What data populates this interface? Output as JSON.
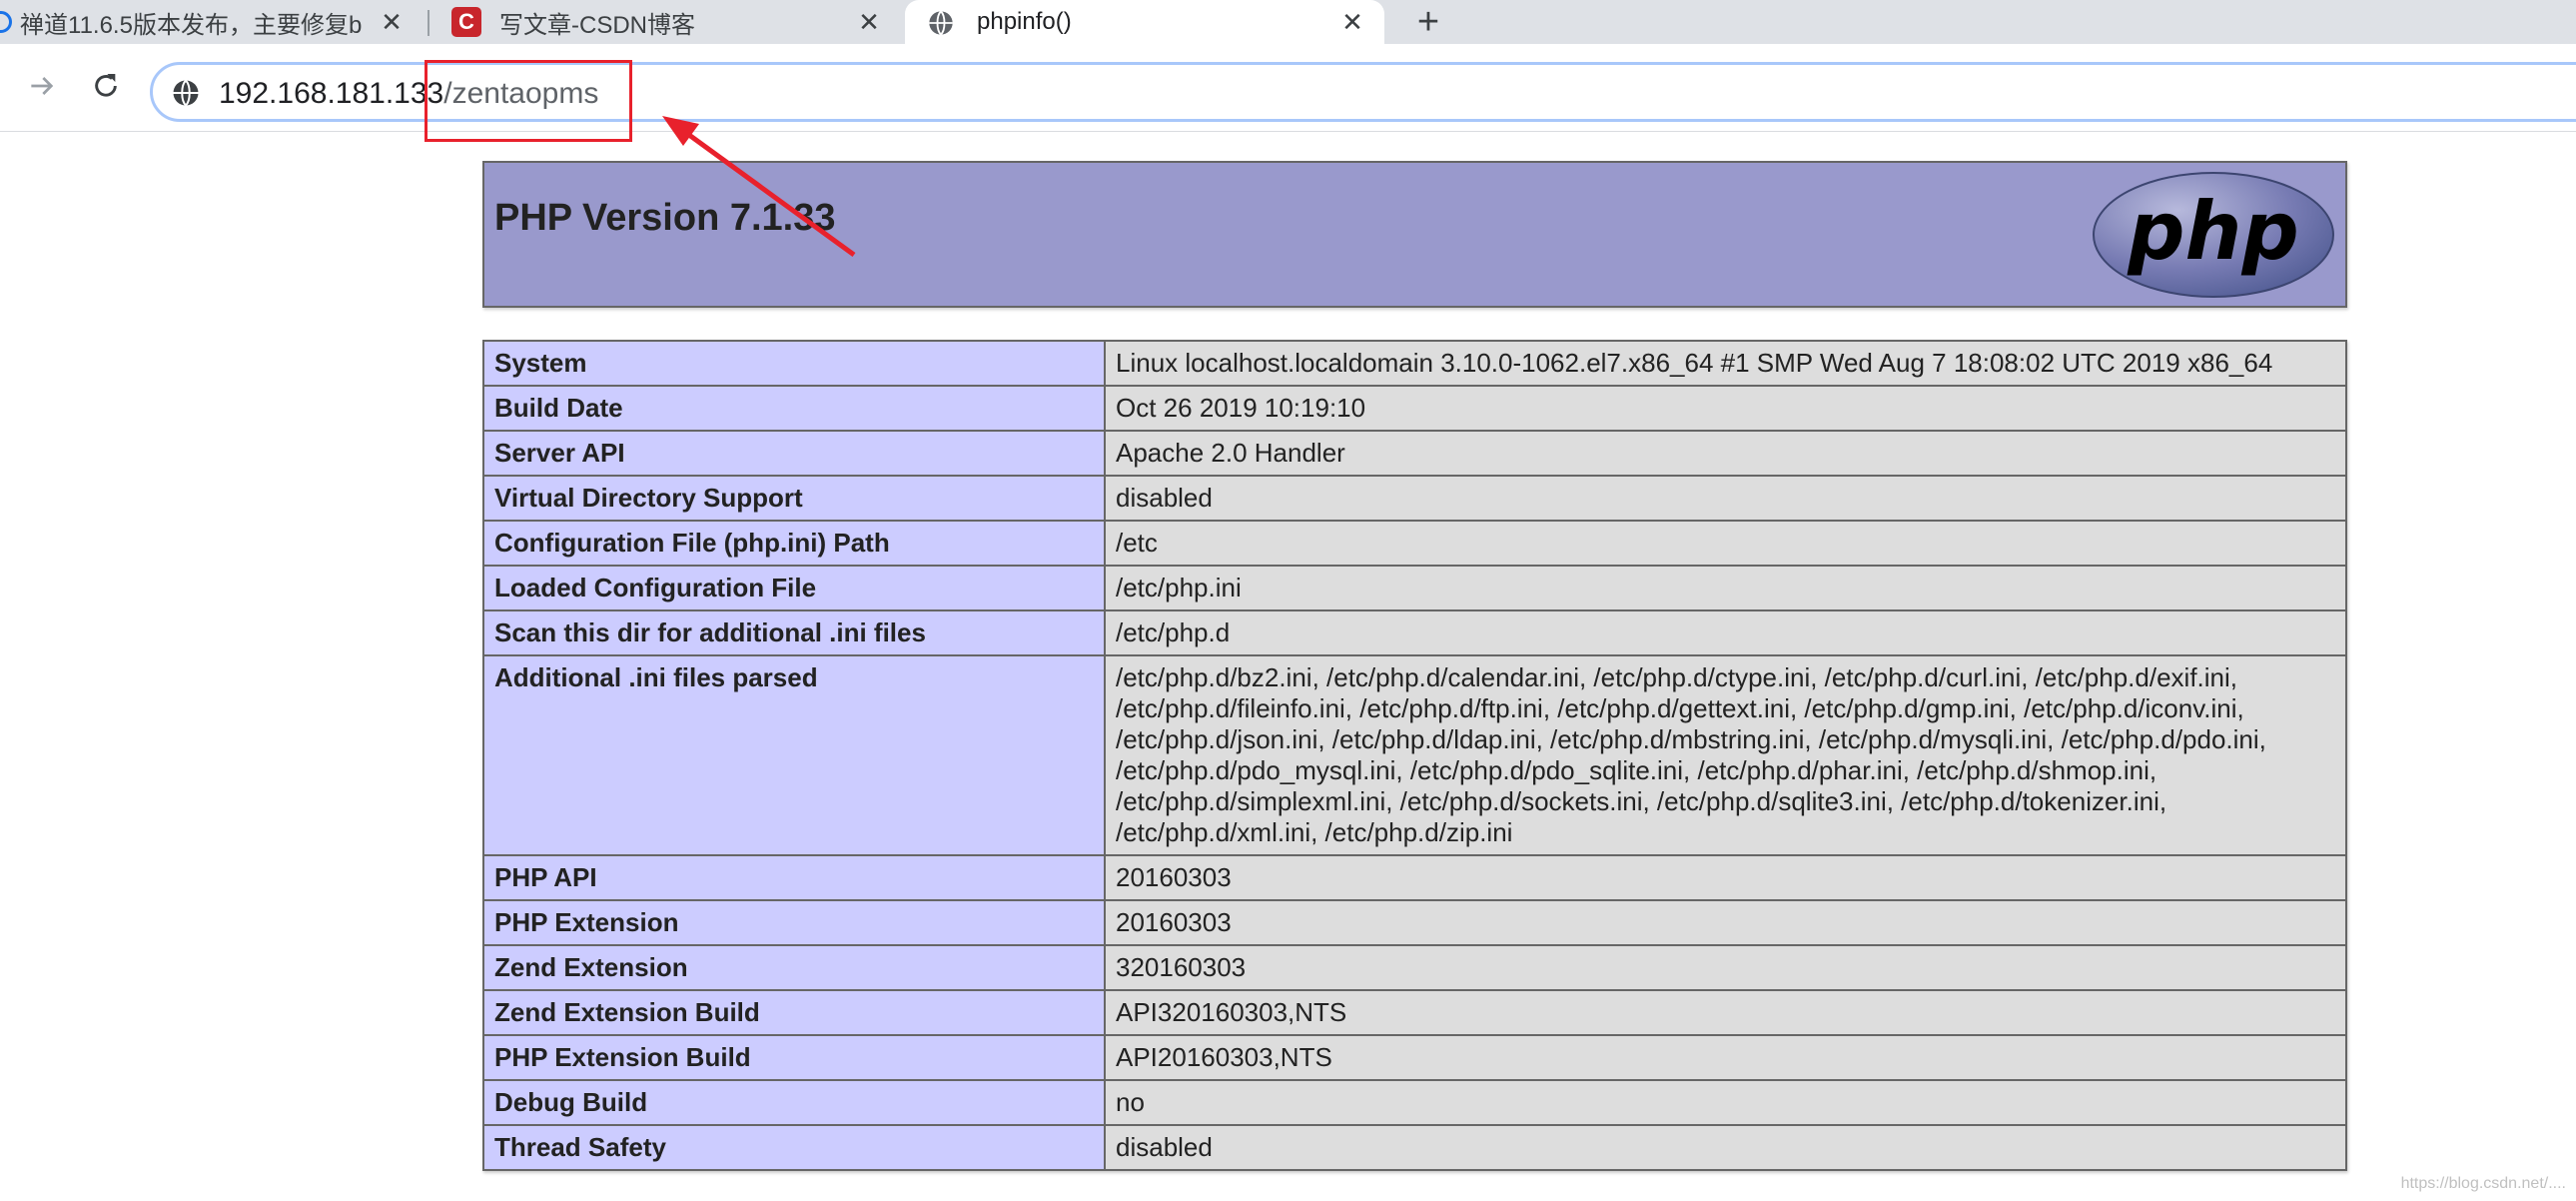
{
  "browser": {
    "tabs": [
      {
        "title": "禅道11.6.5版本发布，主要修复b",
        "icon": "globe-icon"
      },
      {
        "title": "写文章-CSDN博客",
        "icon": "csdn-logo-icon",
        "icon_letter": "C"
      },
      {
        "title": "phpinfo()",
        "icon": "globe-icon"
      }
    ],
    "close_glyph": "✕",
    "new_tab_glyph": "+",
    "address": {
      "host": "192.168.181.133",
      "path": "/zentaopms"
    }
  },
  "colors": {
    "header_bg": "#9999cc",
    "key_cell_bg": "#ccccff",
    "value_cell_bg": "#dddddd",
    "annotation_red": "#e8212c"
  },
  "page": {
    "title": "PHP Version 7.1.33",
    "logo_text": "php",
    "rows": [
      {
        "key": "System",
        "value": "Linux localhost.localdomain 3.10.0-1062.el7.x86_64 #1 SMP Wed Aug 7 18:08:02 UTC 2019 x86_64"
      },
      {
        "key": "Build Date",
        "value": "Oct 26 2019 10:19:10"
      },
      {
        "key": "Server API",
        "value": "Apache 2.0 Handler"
      },
      {
        "key": "Virtual Directory Support",
        "value": "disabled"
      },
      {
        "key": "Configuration File (php.ini) Path",
        "value": "/etc"
      },
      {
        "key": "Loaded Configuration File",
        "value": "/etc/php.ini"
      },
      {
        "key": "Scan this dir for additional .ini files",
        "value": "/etc/php.d"
      },
      {
        "key": "Additional .ini files parsed",
        "value": "/etc/php.d/bz2.ini, /etc/php.d/calendar.ini, /etc/php.d/ctype.ini, /etc/php.d/curl.ini, /etc/php.d/exif.ini, /etc/php.d/fileinfo.ini, /etc/php.d/ftp.ini, /etc/php.d/gettext.ini, /etc/php.d/gmp.ini, /etc/php.d/iconv.ini, /etc/php.d/json.ini, /etc/php.d/ldap.ini, /etc/php.d/mbstring.ini, /etc/php.d/mysqli.ini, /etc/php.d/pdo.ini, /etc/php.d/pdo_mysql.ini, /etc/php.d/pdo_sqlite.ini, /etc/php.d/phar.ini, /etc/php.d/shmop.ini, /etc/php.d/simplexml.ini, /etc/php.d/sockets.ini, /etc/php.d/sqlite3.ini, /etc/php.d/tokenizer.ini, /etc/php.d/xml.ini, /etc/php.d/zip.ini"
      },
      {
        "key": "PHP API",
        "value": "20160303"
      },
      {
        "key": "PHP Extension",
        "value": "20160303"
      },
      {
        "key": "Zend Extension",
        "value": "320160303"
      },
      {
        "key": "Zend Extension Build",
        "value": "API320160303,NTS"
      },
      {
        "key": "PHP Extension Build",
        "value": "API20160303,NTS"
      },
      {
        "key": "Debug Build",
        "value": "no"
      },
      {
        "key": "Thread Safety",
        "value": "disabled"
      }
    ]
  },
  "watermark": "https://blog.csdn.net/...."
}
